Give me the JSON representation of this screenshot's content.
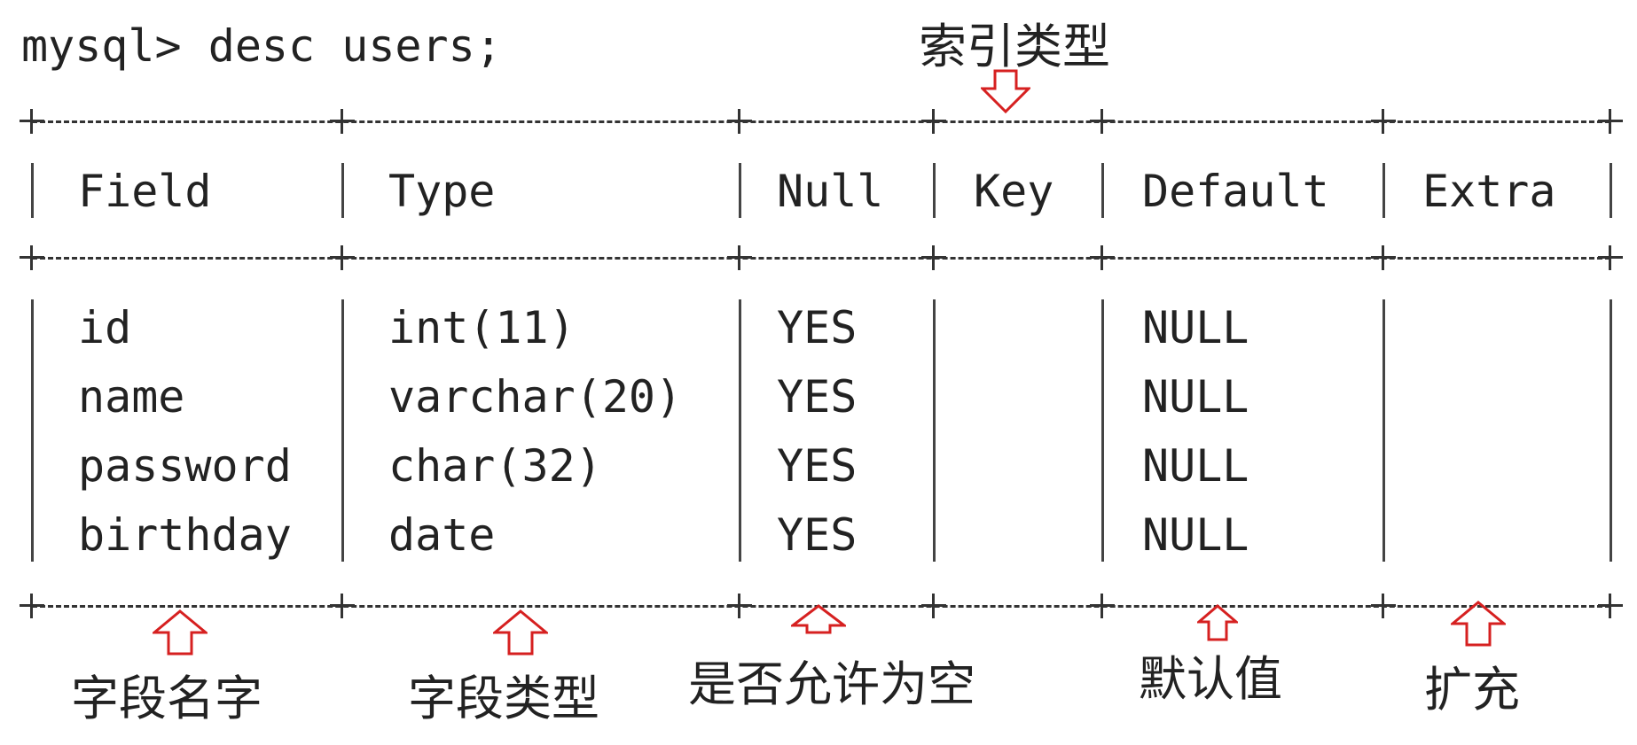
{
  "prompt": "mysql> desc users;",
  "table": {
    "headers": [
      "Field",
      "Type",
      "Null",
      "Key",
      "Default",
      "Extra"
    ],
    "rows": [
      {
        "field": "id",
        "type": "int(11)",
        "null": "YES",
        "key": "",
        "default": "NULL",
        "extra": ""
      },
      {
        "field": "name",
        "type": "varchar(20)",
        "null": "YES",
        "key": "",
        "default": "NULL",
        "extra": ""
      },
      {
        "field": "password",
        "type": "char(32)",
        "null": "YES",
        "key": "",
        "default": "NULL",
        "extra": ""
      },
      {
        "field": "birthday",
        "type": "date",
        "null": "YES",
        "key": "",
        "default": "NULL",
        "extra": ""
      }
    ]
  },
  "annotations": {
    "key": "索引类型",
    "field": "字段名字",
    "type": "字段类型",
    "null": "是否允许为空",
    "default": "默认值",
    "extra": "扩充"
  },
  "colors": {
    "arrow": "#d62020",
    "text": "#222222",
    "border": "#333333"
  }
}
